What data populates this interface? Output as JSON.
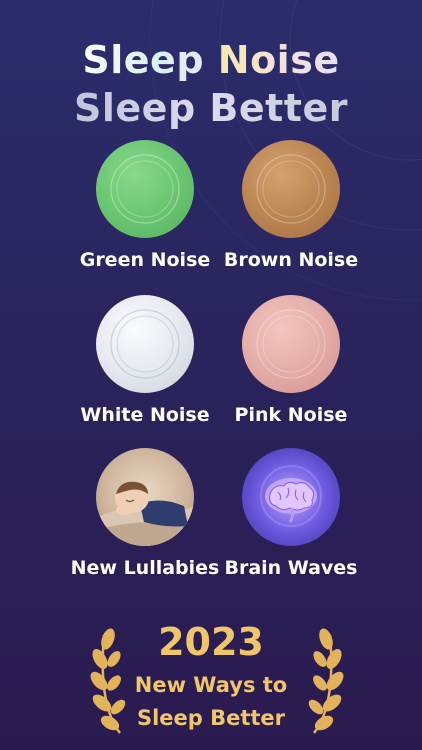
{
  "headline": {
    "line1_word1": "Sleep",
    "line1_word2": "Noise",
    "line2": "Sleep Better"
  },
  "sounds": [
    {
      "label": "Green Noise",
      "icon": "green-noise-circle",
      "color": "#6cc873"
    },
    {
      "label": "Brown Noise",
      "icon": "brown-noise-circle",
      "color": "#bb8553"
    },
    {
      "label": "White Noise",
      "icon": "white-noise-circle",
      "color": "#e6e9ef"
    },
    {
      "label": "Pink Noise",
      "icon": "pink-noise-circle",
      "color": "#e3aaa5"
    },
    {
      "label": "New Lullabies",
      "icon": "sleeping-baby-image"
    },
    {
      "label": "Brain Waves",
      "icon": "brain-image"
    }
  ],
  "award": {
    "year": "2023",
    "line1": "New Ways to",
    "line2": "Sleep Better",
    "icon": "laurel-wreath-icon",
    "color": "#f1c66b"
  },
  "colors": {
    "background": "#2a2660",
    "label": "#ffffff",
    "gold": "#f1c66b"
  }
}
